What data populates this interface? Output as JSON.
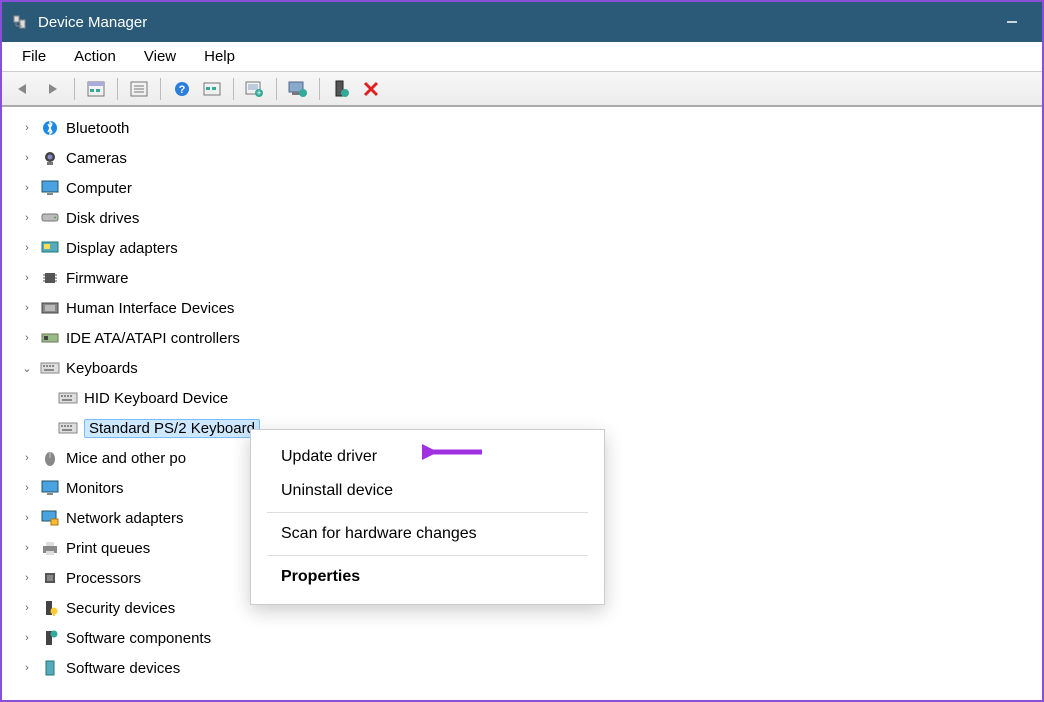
{
  "titlebar": {
    "title": "Device Manager"
  },
  "menubar": {
    "items": [
      "File",
      "Action",
      "View",
      "Help"
    ]
  },
  "tree": {
    "nodes": [
      {
        "label": "Bluetooth",
        "icon": "bluetooth",
        "expanded": false
      },
      {
        "label": "Cameras",
        "icon": "camera",
        "expanded": false
      },
      {
        "label": "Computer",
        "icon": "monitor",
        "expanded": false
      },
      {
        "label": "Disk drives",
        "icon": "disk",
        "expanded": false
      },
      {
        "label": "Display adapters",
        "icon": "display",
        "expanded": false
      },
      {
        "label": "Firmware",
        "icon": "chip",
        "expanded": false
      },
      {
        "label": "Human Interface Devices",
        "icon": "hid",
        "expanded": false
      },
      {
        "label": "IDE ATA/ATAPI controllers",
        "icon": "ide",
        "expanded": false
      },
      {
        "label": "Keyboards",
        "icon": "keyboard",
        "expanded": true,
        "children": [
          {
            "label": "HID Keyboard Device",
            "icon": "keyboard",
            "selected": false
          },
          {
            "label": "Standard PS/2 Keyboard",
            "icon": "keyboard",
            "selected": true
          }
        ]
      },
      {
        "label": "Mice and other pointing devices",
        "icon": "mouse",
        "expanded": false,
        "truncated": "Mice and other po"
      },
      {
        "label": "Monitors",
        "icon": "monitor",
        "expanded": false
      },
      {
        "label": "Network adapters",
        "icon": "network",
        "expanded": false
      },
      {
        "label": "Print queues",
        "icon": "printer",
        "expanded": false
      },
      {
        "label": "Processors",
        "icon": "cpu",
        "expanded": false
      },
      {
        "label": "Security devices",
        "icon": "security",
        "expanded": false
      },
      {
        "label": "Software components",
        "icon": "swcomp",
        "expanded": false
      },
      {
        "label": "Software devices",
        "icon": "swdev",
        "expanded": false
      }
    ]
  },
  "context_menu": {
    "items": [
      {
        "label": "Update driver",
        "bold": false
      },
      {
        "label": "Uninstall device",
        "bold": false
      },
      {
        "sep": true
      },
      {
        "label": "Scan for hardware changes",
        "bold": false
      },
      {
        "sep": true
      },
      {
        "label": "Properties",
        "bold": true
      }
    ]
  }
}
